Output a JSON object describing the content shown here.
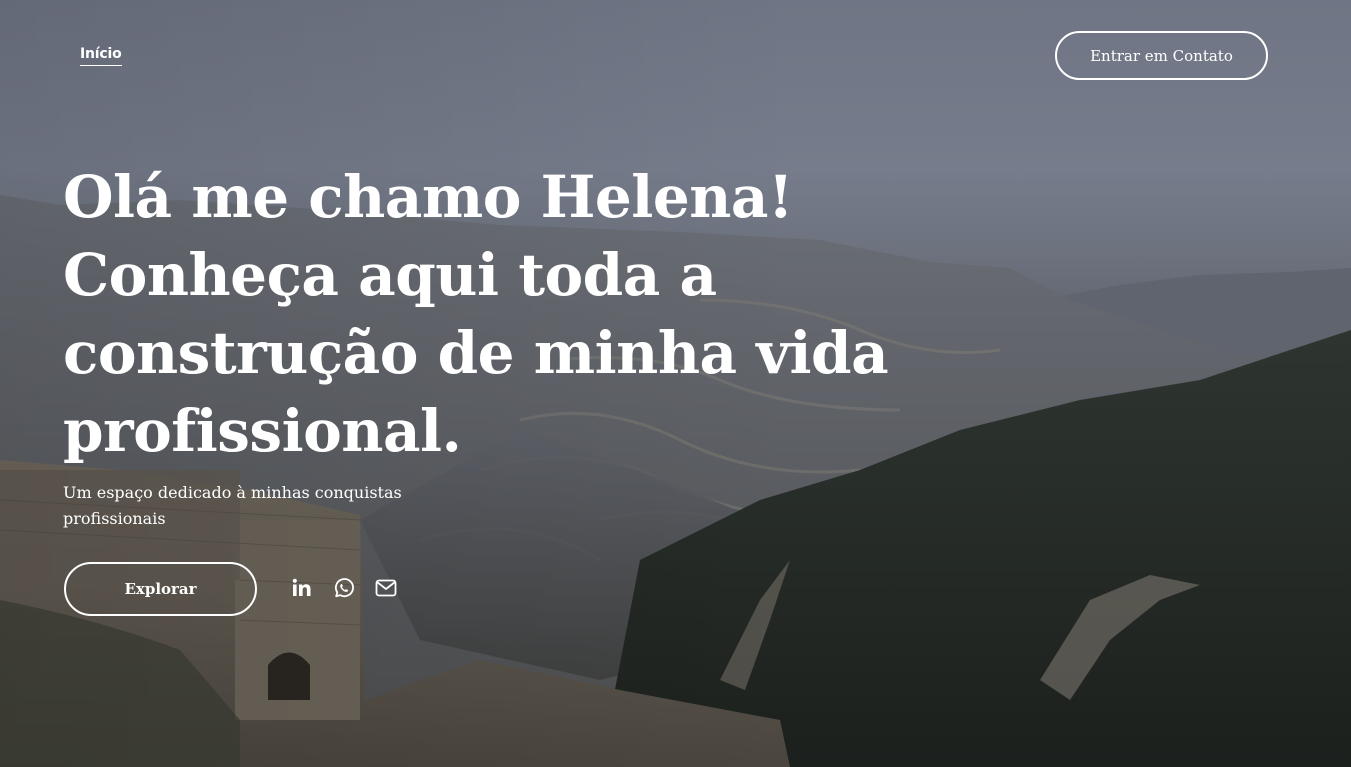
{
  "nav": {
    "home_label": "Início",
    "contact_label": "Entrar em Contato"
  },
  "hero": {
    "headline_lines": [
      "Olá me chamo Helena!",
      "Conheça aqui toda a",
      "construção de minha vida",
      "profissional."
    ],
    "subtitle": "Um espaço dedicado à minhas conquistas profissionais",
    "explore_label": "Explorar"
  },
  "social": {
    "icons": [
      "linkedin-icon",
      "whatsapp-icon",
      "email-icon"
    ]
  },
  "colors": {
    "text": "#ffffff",
    "sky": "#737989",
    "foreground_dark": "#232526"
  }
}
